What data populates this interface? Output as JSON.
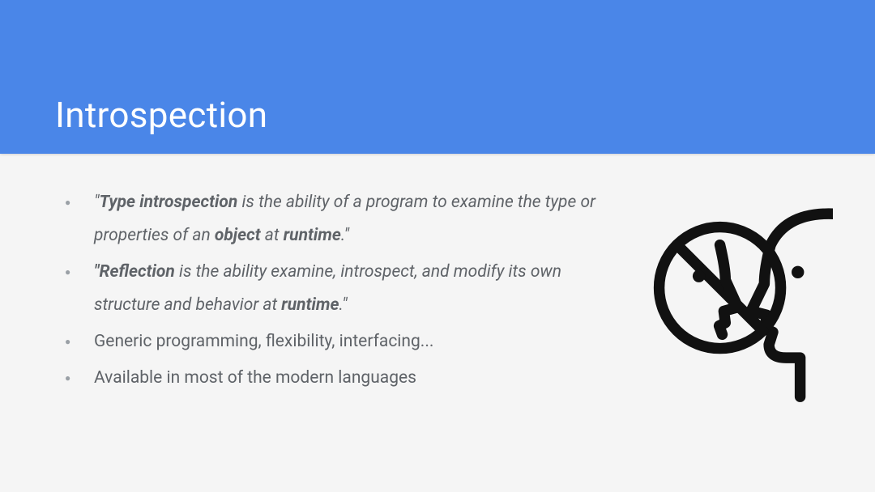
{
  "header": {
    "title": "Introspection"
  },
  "bullets": [
    {
      "segments": [
        {
          "text": "\"",
          "style": "italic"
        },
        {
          "text": "Type introspection",
          "style": "bolditalic"
        },
        {
          "text": " is the ability of a program to examine the type or properties of an ",
          "style": "italic"
        },
        {
          "text": "object",
          "style": "bolditalic"
        },
        {
          "text": " at ",
          "style": "italic"
        },
        {
          "text": "runtime",
          "style": "bolditalic"
        },
        {
          "text": ".\"",
          "style": "italic"
        }
      ]
    },
    {
      "segments": [
        {
          "text": "\"Reflection",
          "style": "bolditalic"
        },
        {
          "text": " is the ability examine, introspect, and modify its own structure and behavior at ",
          "style": "italic"
        },
        {
          "text": "runtime",
          "style": "bolditalic"
        },
        {
          "text": ".\"",
          "style": "italic"
        }
      ]
    },
    {
      "segments": [
        {
          "text": "Generic programming, flexibility, interfacing...",
          "style": "normal"
        }
      ]
    },
    {
      "segments": [
        {
          "text": "Available in most of the modern languages",
          "style": "normal"
        }
      ]
    }
  ],
  "icon_name": "introspection-faces-icon"
}
